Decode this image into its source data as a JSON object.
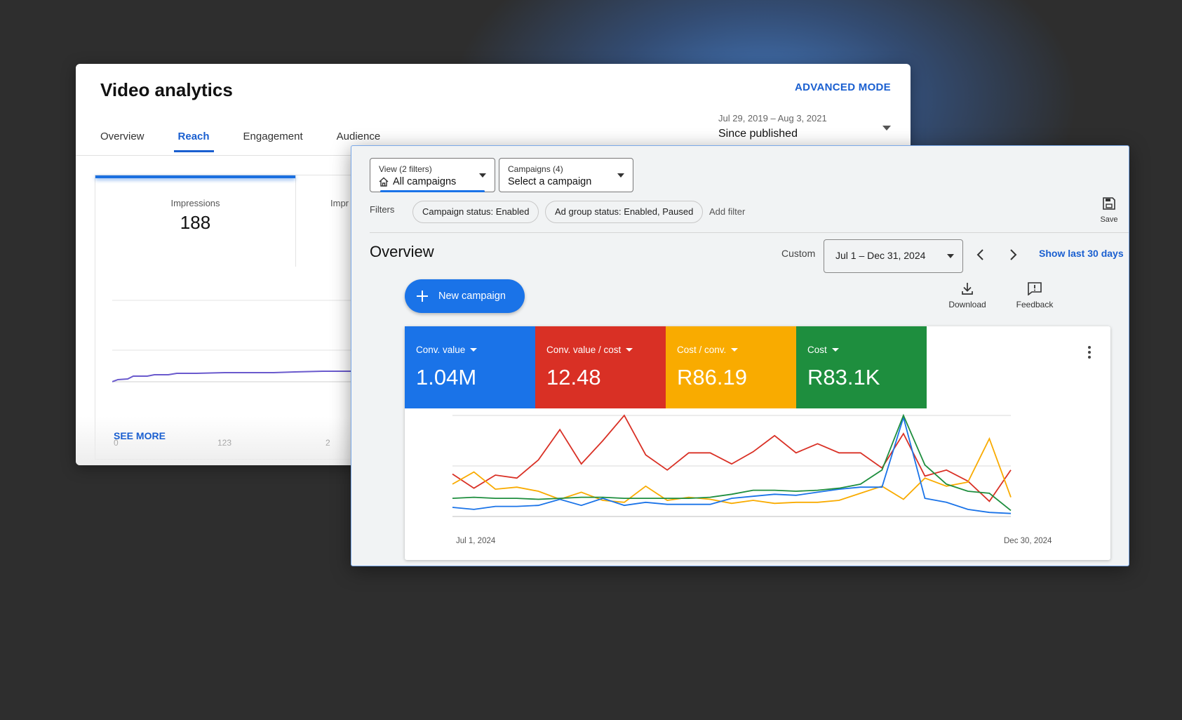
{
  "video_analytics": {
    "title": "Video analytics",
    "advanced_mode": "ADVANCED MODE",
    "tabs": [
      "Overview",
      "Reach",
      "Engagement",
      "Audience"
    ],
    "active_tab": "Reach",
    "date_range": "Jul 29, 2019 – Aug 3, 2021",
    "date_label": "Since published",
    "metric": {
      "label": "Impressions",
      "value": "188"
    },
    "metric2_label_partial": "Impr",
    "x_ticks": [
      "0",
      "123",
      "2"
    ],
    "see_more": "SEE MORE",
    "line_color": "#6a5acd"
  },
  "ads": {
    "view_dropdown": {
      "small": "View (2 filters)",
      "main": "All campaigns"
    },
    "campaigns_dropdown": {
      "small": "Campaigns (4)",
      "main": "Select a campaign"
    },
    "filters_label": "Filters",
    "filter_chips": [
      "Campaign status: Enabled",
      "Ad group status: Enabled, Paused"
    ],
    "add_filter": "Add filter",
    "save_label": "Save",
    "overview_title": "Overview",
    "custom_label": "Custom",
    "date_range": "Jul 1 – Dec 31, 2024",
    "show_last": "Show last 30 days",
    "new_campaign": "New campaign",
    "download": "Download",
    "feedback": "Feedback",
    "tiles": [
      {
        "label": "Conv. value",
        "value": "1.04M",
        "color": "#1a73e8"
      },
      {
        "label": "Conv. value / cost",
        "value": "12.48",
        "color": "#d93025"
      },
      {
        "label": "Cost / conv.",
        "value": "R86.19",
        "color": "#f9ab00"
      },
      {
        "label": "Cost",
        "value": "R83.1K",
        "color": "#1e8e3e"
      }
    ],
    "x_start": "Jul 1, 2024",
    "x_end": "Dec 30, 2024"
  },
  "chart_data": {
    "type": "line",
    "x_start": "Jul 1, 2024",
    "x_end": "Dec 30, 2024",
    "grid": true,
    "ylim": [
      0,
      100
    ],
    "series": [
      {
        "name": "Conv. value / cost",
        "color": "#d93025",
        "values": [
          42,
          28,
          41,
          38,
          56,
          86,
          52,
          75,
          100,
          61,
          46,
          63,
          63,
          52,
          64,
          80,
          63,
          72,
          63,
          63,
          48,
          82,
          40,
          46,
          35,
          15,
          46
        ]
      },
      {
        "name": "Cost / conv.",
        "color": "#f9ab00",
        "values": [
          32,
          44,
          27,
          29,
          25,
          17,
          24,
          16,
          14,
          30,
          16,
          19,
          17,
          13,
          16,
          13,
          14,
          14,
          16,
          23,
          30,
          17,
          38,
          30,
          34,
          77,
          19
        ]
      },
      {
        "name": "Conv. value",
        "color": "#1a73e8",
        "values": [
          9,
          7,
          10,
          10,
          11,
          17,
          11,
          18,
          11,
          14,
          12,
          12,
          12,
          18,
          20,
          22,
          21,
          24,
          27,
          29,
          29,
          98,
          18,
          14,
          7,
          4,
          3
        ]
      },
      {
        "name": "Cost",
        "color": "#1e8e3e",
        "values": [
          18,
          19,
          18,
          18,
          17,
          18,
          19,
          19,
          18,
          18,
          18,
          18,
          19,
          22,
          26,
          26,
          25,
          26,
          28,
          32,
          46,
          100,
          51,
          32,
          25,
          23,
          6
        ]
      }
    ]
  }
}
